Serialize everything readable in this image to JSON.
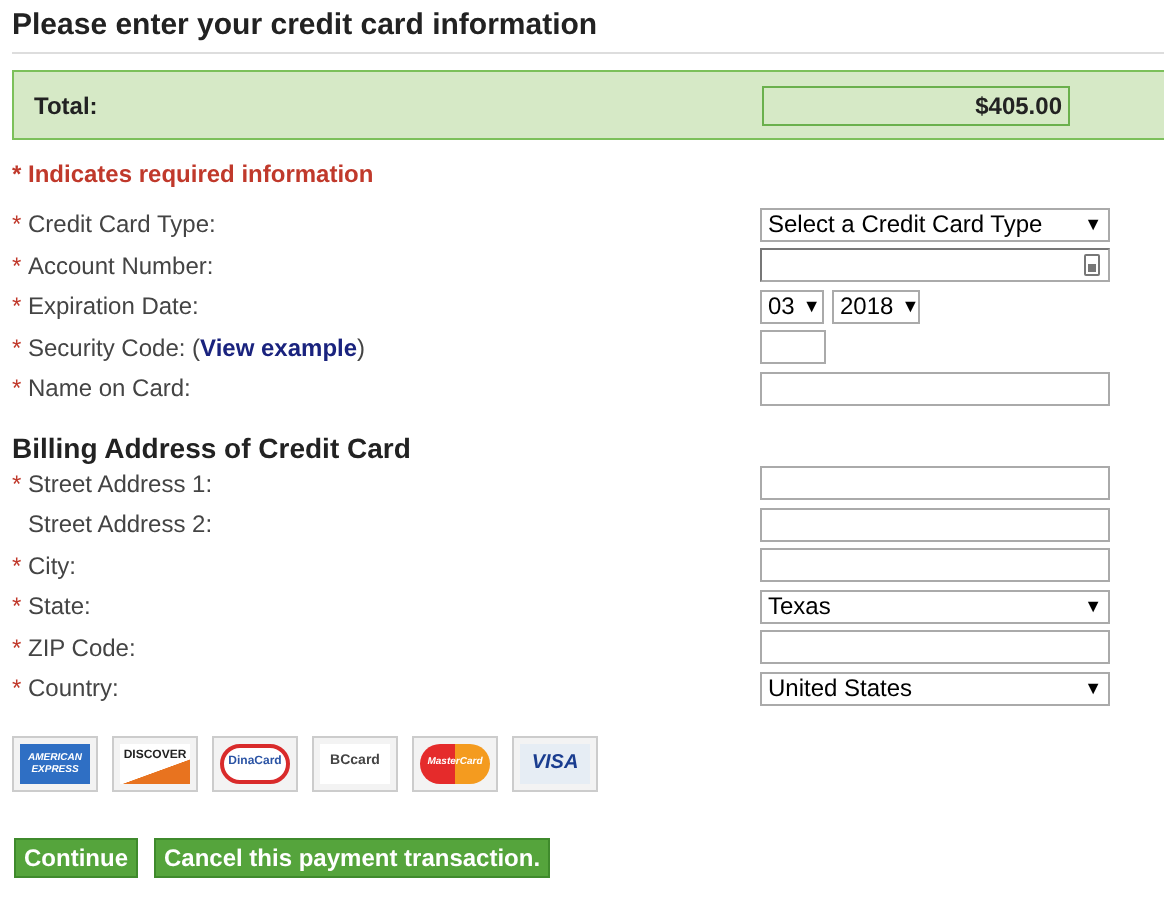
{
  "title": "Please enter your credit card information",
  "total": {
    "label": "Total:",
    "value": "$405.00"
  },
  "required_mark": "*",
  "dropdown_arrow": "▼",
  "required_note": "* Indicates required information",
  "card_fields": [
    {
      "kind": "select",
      "required": true,
      "label": "Credit Card Type:",
      "value": "Select a Credit Card Type"
    },
    {
      "kind": "account",
      "required": true,
      "label": "Account Number:"
    },
    {
      "kind": "date",
      "required": true,
      "label": "Expiration Date:",
      "month": "03",
      "year": "2018"
    },
    {
      "kind": "cvv",
      "required": true,
      "label": "Security Code: (",
      "link": "View example",
      "label_after": ")"
    },
    {
      "kind": "text",
      "required": true,
      "label": "Name on Card:"
    }
  ],
  "billing_heading": "Billing Address of Credit Card",
  "billing_fields": [
    {
      "kind": "text",
      "required": true,
      "label": "Street Address 1:"
    },
    {
      "kind": "text",
      "required": false,
      "label": "Street Address 2:"
    },
    {
      "kind": "text",
      "required": true,
      "label": "City:"
    },
    {
      "kind": "select",
      "required": true,
      "label": "State:",
      "value": "Texas"
    },
    {
      "kind": "text",
      "required": true,
      "label": "ZIP Code:"
    },
    {
      "kind": "select",
      "required": true,
      "label": "Country:",
      "value": "United States"
    }
  ],
  "cards": [
    {
      "kind": "amex",
      "lines": [
        "AMERICAN",
        "EXPRESS"
      ]
    },
    {
      "kind": "discover",
      "lines": [
        "DISCOVER"
      ]
    },
    {
      "kind": "dina",
      "lines": [
        "DinaCard"
      ]
    },
    {
      "kind": "bc",
      "lines": [
        "BCcard"
      ]
    },
    {
      "kind": "master",
      "lines": [
        "MasterCard"
      ]
    },
    {
      "kind": "visa",
      "lines": [
        "VISA"
      ]
    }
  ],
  "buttons": [
    "Continue",
    "Cancel this payment transaction."
  ]
}
